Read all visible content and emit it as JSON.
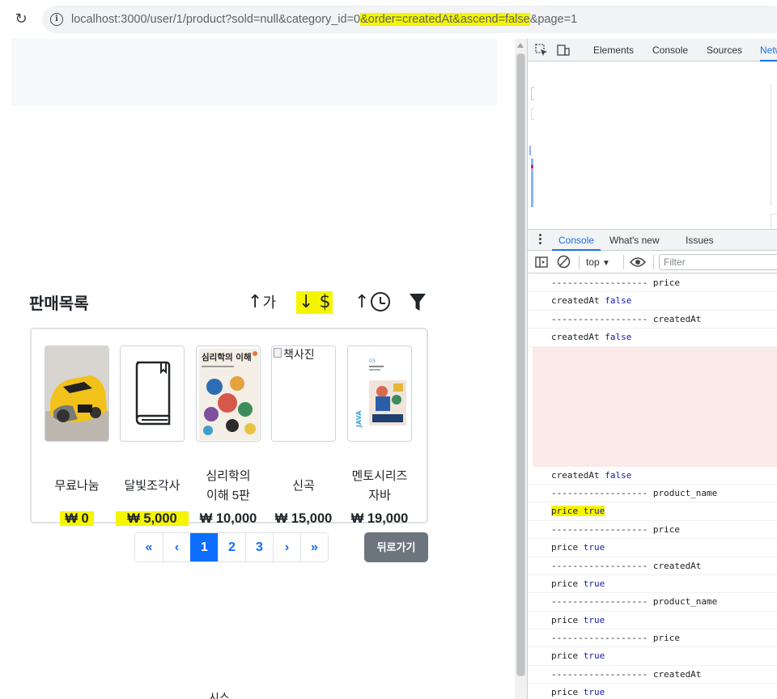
{
  "browser": {
    "url_pre": "localhost:3000/user/1/product?sold=null&category_id=0",
    "url_hl": "&order=createdAt&ascend=false",
    "url_post": "&page=1"
  },
  "page": {
    "section_title": "판매목록",
    "sort_buttons": [
      {
        "arrow": "↑",
        "label": "가"
      },
      {
        "arrow": "↓",
        "label": "$"
      },
      {
        "arrow": "↑",
        "label": ""
      }
    ],
    "products": [
      {
        "name": "무료나눔",
        "price": "₩ 0",
        "image": "yellow-sports-car-toy"
      },
      {
        "name": "달빛조각사",
        "price": "₩ 5,000",
        "image": "book-icon"
      },
      {
        "name": "심리학의 이해 5판",
        "price": "₩ 10,000",
        "image": "book-cover-psychology",
        "cover_title": "심리학의 이해"
      },
      {
        "name": "신곡",
        "price": "₩ 15,000",
        "image": "broken-image",
        "alt": "책사진"
      },
      {
        "name": "멘토시리즈 자바",
        "price": "₩ 19,000",
        "image": "book-cover-java",
        "cover_text": "JAVA"
      }
    ],
    "pagination": [
      "«",
      "‹",
      "1",
      "2",
      "3",
      "›",
      "»"
    ],
    "active_page": "1",
    "back_label": "뒤로가기",
    "bottom_text": "시스"
  },
  "devtools": {
    "tabs": [
      "Elements",
      "Console",
      "Sources",
      "Netw"
    ],
    "active_tab": "Netw",
    "drawer_tabs": [
      "Console",
      "What's new",
      "Issues"
    ],
    "context": "top",
    "filter_placeholder": "Filter",
    "log_lines": [
      {
        "text": "------------------ price"
      },
      {
        "text": "createdAt ",
        "bool": "false"
      },
      {
        "text": "------------------ createdAt"
      },
      {
        "text": "createdAt ",
        "bool": "false"
      },
      {
        "redacted": true
      },
      {
        "text": "createdAt ",
        "bool": "false"
      },
      {
        "text": "------------------ product_name"
      },
      {
        "text": "price ",
        "bool": "true",
        "highlight": true
      },
      {
        "text": "------------------ price"
      },
      {
        "text": "price ",
        "bool": "true"
      },
      {
        "text": "------------------ createdAt"
      },
      {
        "text": "price ",
        "bool": "true"
      },
      {
        "text": "------------------ product_name"
      },
      {
        "text": "price ",
        "bool": "true"
      },
      {
        "text": "------------------ price"
      },
      {
        "text": "price ",
        "bool": "true"
      },
      {
        "text": "------------------ createdAt"
      },
      {
        "text": "price ",
        "bool": "true"
      }
    ]
  },
  "colors": {
    "highlight": "#f5f500",
    "primary": "#0d6efd",
    "secondary": "#6c757d",
    "devtools_blue": "#1a73e8"
  }
}
